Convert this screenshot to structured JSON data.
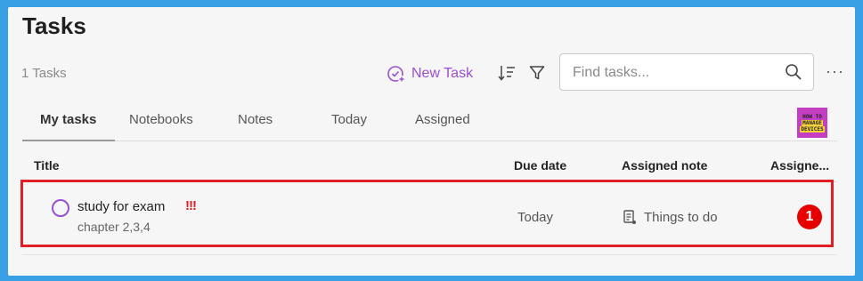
{
  "page": {
    "title": "Tasks",
    "count_label": "1 Tasks"
  },
  "toolbar": {
    "new_task_label": "New Task",
    "search_placeholder": "Find tasks...",
    "more_label": "···"
  },
  "tabs": [
    {
      "label": "My tasks",
      "active": true
    },
    {
      "label": "Notebooks"
    },
    {
      "label": "Notes"
    },
    {
      "label": "Today"
    },
    {
      "label": "Assigned"
    }
  ],
  "logo": {
    "lines": [
      "HOW TO",
      "MANAGE",
      "DEVICES"
    ]
  },
  "columns": {
    "title": "Title",
    "due_date": "Due date",
    "assigned_note": "Assigned note",
    "assigned": "Assigne..."
  },
  "task": {
    "title": "study for exam",
    "priority": "!!!",
    "subtitle": "chapter 2,3,4",
    "due": "Today",
    "note": "Things to do"
  },
  "annotation": {
    "badge": "1"
  },
  "colors": {
    "accent": "#9a4fd6",
    "highlight": "#e01f26",
    "badge": "#e60000",
    "frame": "#3aa0e6"
  },
  "icons": [
    "new-task-icon",
    "sort-icon",
    "filter-icon",
    "search-icon",
    "more-icon",
    "note-icon",
    "task-checkbox"
  ]
}
